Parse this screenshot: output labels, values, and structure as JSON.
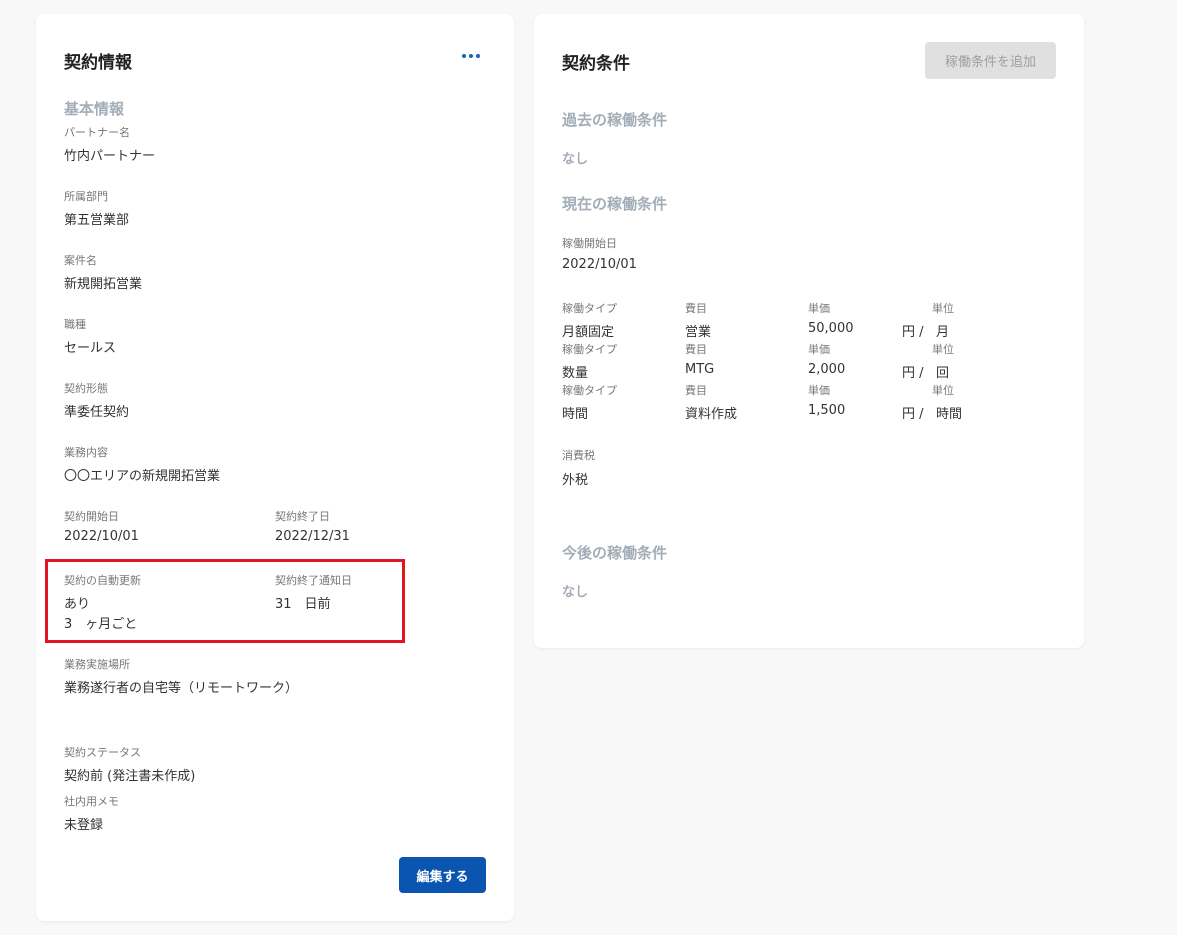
{
  "contract_info": {
    "title": "契約情報",
    "section_title": "基本情報",
    "fields": {
      "partner_name": {
        "label": "パートナー名",
        "value": "竹内パートナー"
      },
      "department": {
        "label": "所属部門",
        "value": "第五営業部"
      },
      "project_name": {
        "label": "案件名",
        "value": "新規開拓営業"
      },
      "job_type": {
        "label": "職種",
        "value": "セールス"
      },
      "contract_form": {
        "label": "契約形態",
        "value": "準委任契約"
      },
      "business_content": {
        "label": "業務内容",
        "value": "〇〇エリアの新規開拓営業"
      },
      "start_date": {
        "label": "契約開始日",
        "value": "2022/10/01"
      },
      "end_date": {
        "label": "契約終了日",
        "value": "2022/12/31"
      },
      "auto_renewal": {
        "label": "契約の自動更新",
        "value": "あり",
        "interval": "3　ヶ月ごと"
      },
      "end_notice": {
        "label": "契約終了通知日",
        "value": "31　日前"
      },
      "work_location": {
        "label": "業務実施場所",
        "value": "業務遂行者の自宅等（リモートワーク）"
      },
      "status": {
        "label": "契約ステータス",
        "value": "契約前 (発注書未作成)"
      },
      "memo": {
        "label": "社内用メモ",
        "value": "未登録"
      }
    },
    "edit_button": "編集する"
  },
  "contract_terms": {
    "title": "契約条件",
    "add_button": "稼働条件を追加",
    "past": {
      "title": "過去の稼働条件",
      "value": "なし"
    },
    "current": {
      "title": "現在の稼働条件",
      "start_label": "稼働開始日",
      "start_value": "2022/10/01",
      "headers": {
        "type": "稼働タイプ",
        "item": "費目",
        "price": "単価",
        "unit": "単位"
      },
      "rows": [
        {
          "type": "月額固定",
          "item": "営業",
          "price": "50,000",
          "yen": "円 /",
          "unit": "月"
        },
        {
          "type": "数量",
          "item": "MTG",
          "price": "2,000",
          "yen": "円 /",
          "unit": "回"
        },
        {
          "type": "時間",
          "item": "資料作成",
          "price": "1,500",
          "yen": "円 /",
          "unit": "時間"
        }
      ],
      "tax_label": "消費税",
      "tax_value": "外税"
    },
    "future": {
      "title": "今後の稼働条件",
      "value": "なし"
    }
  },
  "colors": {
    "accent": "#0a55b0",
    "highlight": "#e0171f",
    "muted_title": "#a3adb8"
  }
}
